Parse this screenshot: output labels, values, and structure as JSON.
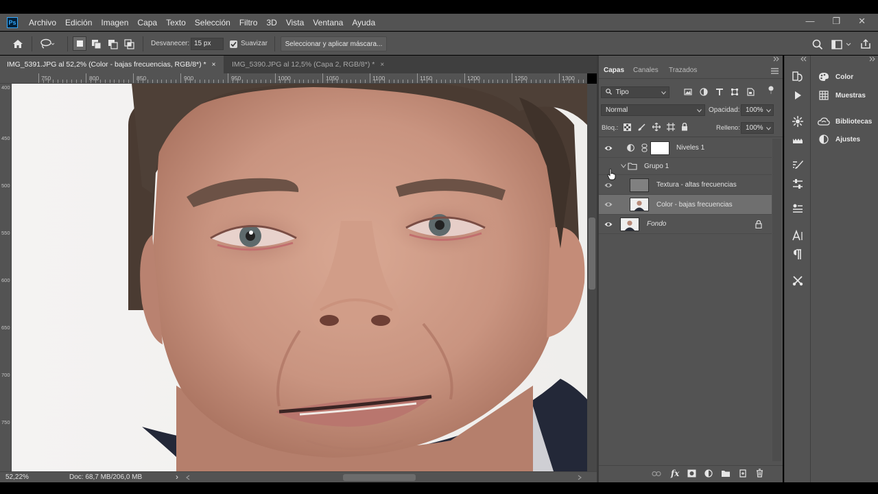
{
  "app": {
    "logo_text": "Ps"
  },
  "menu": [
    "Archivo",
    "Edición",
    "Imagen",
    "Capa",
    "Texto",
    "Selección",
    "Filtro",
    "3D",
    "Vista",
    "Ventana",
    "Ayuda"
  ],
  "window_controls": {
    "minimize": "—",
    "restore": "❐",
    "close": "✕"
  },
  "options": {
    "feather_label": "Desvanecer:",
    "feather_value": "15 px",
    "smooth_label": "Suavizar",
    "smooth_checked": true,
    "mask_button": "Seleccionar y aplicar máscara..."
  },
  "tabs": [
    {
      "label": "IMG_5391.JPG al 52,2% (Color - bajas frecuencias, RGB/8*) *",
      "close": "×",
      "active": true
    },
    {
      "label": "IMG_5390.JPG al 12,5% (Capa 2, RGB/8*) *",
      "close": "×",
      "active": false
    }
  ],
  "ruler_top": [
    "750",
    "800",
    "850",
    "900",
    "950",
    "1000",
    "1050",
    "1100",
    "1150",
    "1200",
    "1250",
    "1300"
  ],
  "ruler_left": [
    "400",
    "450",
    "500",
    "550",
    "600",
    "650",
    "700",
    "750"
  ],
  "status": {
    "zoom": "52,22%",
    "doc": "Doc: 68,7 MB/206,0 MB",
    "arrow": "›"
  },
  "panel": {
    "tabs": [
      "Capas",
      "Canales",
      "Trazados"
    ],
    "filter_kind": "Tipo",
    "blend_mode": "Normal",
    "opacity_label": "Opacidad:",
    "opacity_value": "100%",
    "lock_label": "Bloq.:",
    "fill_label": "Relleno:",
    "fill_value": "100%",
    "layers": [
      {
        "name": "Niveles 1",
        "kind": "adjustment",
        "visible": true
      },
      {
        "name": "Grupo 1",
        "kind": "group",
        "visible": false
      },
      {
        "name": "Textura - altas frecuencias",
        "kind": "pixel",
        "visible": true
      },
      {
        "name": "Color - bajas frecuencias",
        "kind": "pixel",
        "visible": true,
        "selected": true
      },
      {
        "name": "Fondo",
        "kind": "background",
        "visible": true,
        "locked": true
      }
    ]
  },
  "right_panels": [
    "Color",
    "Muestras",
    "Bibliotecas",
    "Ajustes"
  ],
  "colors": {
    "panel_bg": "#535353",
    "dark_bg": "#3f3f3f",
    "selected_layer": "#6f6f6f",
    "ps_blue": "#31a8ff"
  }
}
